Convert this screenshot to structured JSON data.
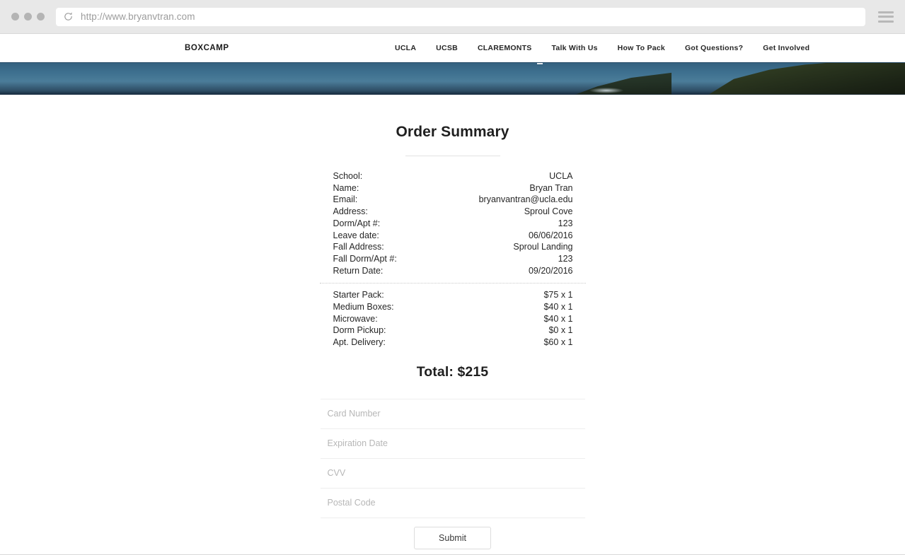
{
  "browser": {
    "url": "http://www.bryanvtran.com",
    "reload_icon": "reload-icon",
    "menu_icon": "hamburger-menu-icon"
  },
  "site_nav": {
    "brand": "BOXCAMP",
    "links": [
      "UCLA",
      "UCSB",
      "CLAREMONTS",
      "Talk With Us",
      "How To Pack",
      "Got Questions?",
      "Get Involved"
    ]
  },
  "main": {
    "title": "Order Summary",
    "details": [
      {
        "label": "School:",
        "value": "UCLA"
      },
      {
        "label": "Name:",
        "value": "Bryan Tran"
      },
      {
        "label": "Email:",
        "value": "bryanvantran@ucla.edu"
      },
      {
        "label": "Address:",
        "value": "Sproul Cove"
      },
      {
        "label": "Dorm/Apt #:",
        "value": "123"
      },
      {
        "label": "Leave date:",
        "value": "06/06/2016"
      },
      {
        "label": "Fall Address:",
        "value": "Sproul Landing"
      },
      {
        "label": "Fall Dorm/Apt #:",
        "value": "123"
      },
      {
        "label": "Return Date:",
        "value": "09/20/2016"
      }
    ],
    "items": [
      {
        "label": "Starter Pack:",
        "value": "$75 x 1"
      },
      {
        "label": "Medium Boxes:",
        "value": "$40 x 1"
      },
      {
        "label": "Microwave:",
        "value": "$40 x 1"
      },
      {
        "label": "Dorm Pickup:",
        "value": "$0 x 1"
      },
      {
        "label": "Apt. Delivery:",
        "value": "$60 x 1"
      }
    ],
    "total": "Total: $215"
  },
  "payment": {
    "card_number_placeholder": "Card Number",
    "card_number_value": "",
    "expiration_placeholder": "Expiration Date",
    "expiration_value": "",
    "cvv_placeholder": "CVV",
    "cvv_value": "",
    "postal_placeholder": "Postal Code",
    "postal_value": "",
    "submit_label": "Submit"
  },
  "colors": {
    "chrome_bg": "#e8e8e8",
    "text": "#262626",
    "placeholder": "#b7b7b7",
    "divider": "#eeeeee",
    "hero_sea": "#3d6f8e",
    "hero_land": "#2e3a21"
  }
}
